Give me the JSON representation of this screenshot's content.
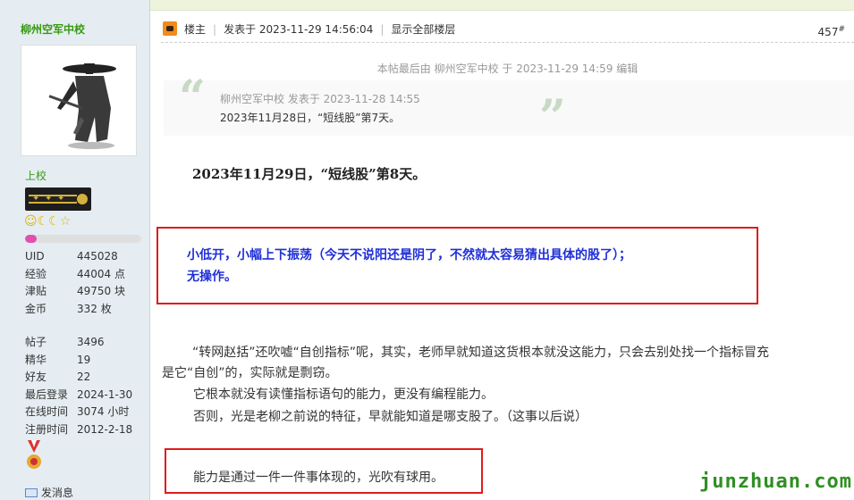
{
  "sidebar": {
    "username": "柳州空军中校",
    "rank": "上校",
    "medal_icons": "☺☾☾☆",
    "credit_progress": 0.1,
    "stats_group1": [
      {
        "label": "UID",
        "value": "445028"
      },
      {
        "label": "经验",
        "value": "44004 点"
      },
      {
        "label": "津贴",
        "value": "49750 块"
      },
      {
        "label": "金币",
        "value": "332 枚"
      }
    ],
    "stats_group2": [
      {
        "label": "帖子",
        "value": "3496"
      },
      {
        "label": "精华",
        "value": "19"
      },
      {
        "label": "好友",
        "value": "22"
      },
      {
        "label": "最后登录",
        "value": "2024-1-30"
      },
      {
        "label": "在线时间",
        "value": "3074 小时"
      },
      {
        "label": "注册时间",
        "value": "2012-2-18"
      }
    ],
    "pm_label": "发消息"
  },
  "post": {
    "op_label": "楼主",
    "posted_at": "发表于 2023-11-29 14:56:04",
    "show_all": "显示全部楼层",
    "floor": "457",
    "floor_suffix": "#",
    "edit_note": "本帖最后由 柳州空军中校 于 2023-11-29 14:59 编辑",
    "quote_meta": "柳州空军中校 发表于 2023-11-28 14:55",
    "quote_body": "2023年11月28日，“短线股”第7天。",
    "title": "2023年11月29日，“短线股”第8天。",
    "blue_line1": "小低开，小幅上下振荡（今天不说阳还是阴了，不然就太容易猜出具体的股了）；",
    "blue_line2": "无操作。",
    "para1_line1": "“转网赵括”还吹嘘“自创指标”呢，其实，老师早就知道这货根本就没这能力，只会去别处找一个指标冒充",
    "para1_line2": "是它“自创”的，实际就是剽窃。",
    "para2": "它根本就没有读懂指标语句的能力，更没有编程能力。",
    "para3": "否则，光是老柳之前说的特征，早就能知道是哪支股了。（这事以后说）",
    "para4": "能力是通过一件一件事体现的，光吹有球用。"
  },
  "watermark": "junzhuan.com"
}
